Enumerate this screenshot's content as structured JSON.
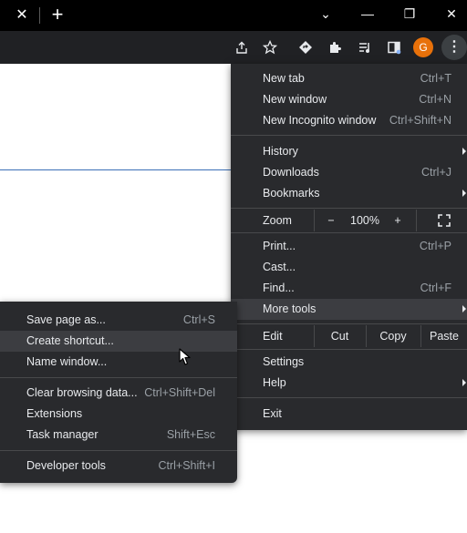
{
  "tabstrip": {
    "close_tab_glyph": "✕",
    "new_tab_glyph": "+",
    "minimize_glyph": "—",
    "restore_glyph": "❐",
    "close_window_glyph": "✕",
    "tab_search_glyph": "⌄"
  },
  "toolbar": {
    "avatar_initial": "G",
    "kebab_glyph": "⋮",
    "icons": [
      "share-icon",
      "star-icon",
      "extension-direction-icon",
      "puzzle-icon",
      "media-control-icon",
      "sidepanel-icon",
      "profile-avatar",
      "menu-icon"
    ]
  },
  "menu": {
    "new_tab": {
      "label": "New tab",
      "shortcut": "Ctrl+T"
    },
    "new_window": {
      "label": "New window",
      "shortcut": "Ctrl+N"
    },
    "new_incognito": {
      "label": "New Incognito window",
      "shortcut": "Ctrl+Shift+N"
    },
    "history": {
      "label": "History"
    },
    "downloads": {
      "label": "Downloads",
      "shortcut": "Ctrl+J"
    },
    "bookmarks": {
      "label": "Bookmarks"
    },
    "zoom": {
      "label": "Zoom",
      "minus": "−",
      "value": "100%",
      "plus": "+"
    },
    "print": {
      "label": "Print...",
      "shortcut": "Ctrl+P"
    },
    "cast": {
      "label": "Cast..."
    },
    "find": {
      "label": "Find...",
      "shortcut": "Ctrl+F"
    },
    "more_tools": {
      "label": "More tools"
    },
    "edit": {
      "label": "Edit",
      "cut": "Cut",
      "copy": "Copy",
      "paste": "Paste"
    },
    "settings": {
      "label": "Settings"
    },
    "help": {
      "label": "Help"
    },
    "exit": {
      "label": "Exit"
    }
  },
  "submenu": {
    "save_page": {
      "label": "Save page as...",
      "shortcut": "Ctrl+S"
    },
    "create_shortcut": {
      "label": "Create shortcut..."
    },
    "name_window": {
      "label": "Name window..."
    },
    "clear_data": {
      "label": "Clear browsing data...",
      "shortcut": "Ctrl+Shift+Del"
    },
    "extensions": {
      "label": "Extensions"
    },
    "task_manager": {
      "label": "Task manager",
      "shortcut": "Shift+Esc"
    },
    "developer_tools": {
      "label": "Developer tools",
      "shortcut": "Ctrl+Shift+I"
    }
  },
  "colors": {
    "menu_bg": "#292a2d",
    "hover_bg": "#3c3d41",
    "text": "#e8eaed",
    "shortcut_text": "#9aa0a6",
    "avatar": "#e8710a"
  }
}
